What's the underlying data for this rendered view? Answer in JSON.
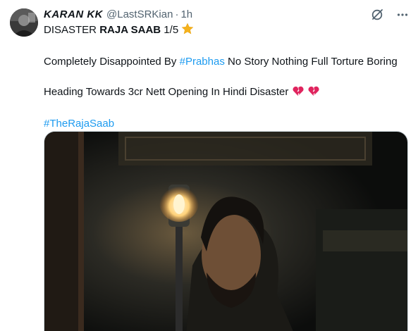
{
  "tweet": {
    "author_name": "KARAN KK",
    "handle": "@LastSRKian",
    "separator": "·",
    "time": "1h",
    "line1_prefix": "DISASTER ",
    "line1_bold": "RAJA SAAB",
    "line1_suffix": " 1/5",
    "line2_prefix": "Completely Disappointed By ",
    "line2_hashtag": "#Prabhas",
    "line2_suffix": " No Story Nothing Full Torture Boring",
    "line3_text": "Heading Towards 3cr Nett Opening In Hindi Disaster",
    "line4_hashtag": "#TheRajaSaab"
  },
  "icons": {
    "star": "star-emoji",
    "broken_heart": "broken-heart-emoji",
    "grok": "grok-icon",
    "more": "more-icon"
  },
  "colors": {
    "link": "#1d9bf0",
    "text": "#0f1419",
    "muted": "#536471",
    "star": "#f5b21c",
    "broken_heart": "#e0245e"
  }
}
